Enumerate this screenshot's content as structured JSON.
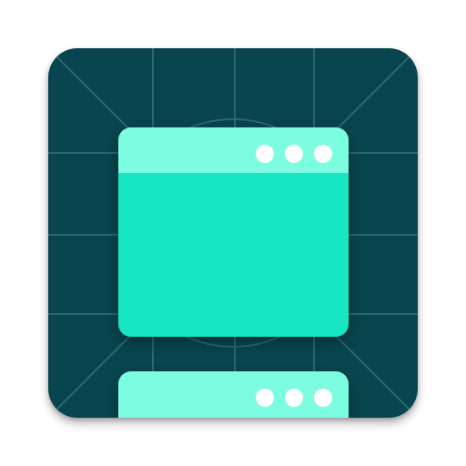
{
  "icon": {
    "name": "app-windows-icon",
    "colors": {
      "background": "#08454f",
      "grid_line": "#2a6872",
      "window_body": "#19e6c1",
      "window_titlebar": "#7cfde0",
      "dot": "#ffffff",
      "shadow": "#00000055"
    },
    "windows": [
      {
        "name": "main-window",
        "dot_count": 3
      },
      {
        "name": "second-window",
        "dot_count": 3
      }
    ]
  }
}
